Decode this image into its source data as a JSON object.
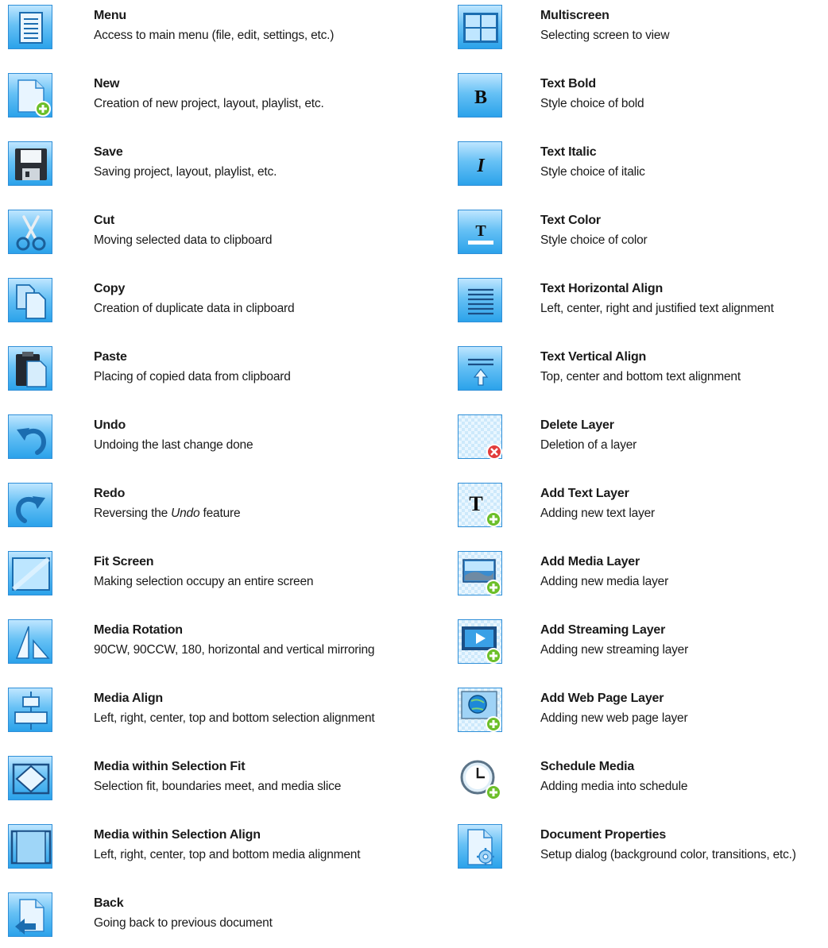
{
  "left_items": [
    {
      "title": "Menu",
      "desc": "Access to main menu  (file, edit, settings, etc.)",
      "icon": "menu-icon"
    },
    {
      "title": "New",
      "desc": "Creation of new project, layout, playlist, etc.",
      "icon": "new-document-icon"
    },
    {
      "title": "Save",
      "desc": "Saving project, layout, playlist, etc.",
      "icon": "floppy-disk-icon"
    },
    {
      "title": "Cut",
      "desc": "Moving selected data to clipboard",
      "icon": "scissors-icon"
    },
    {
      "title": "Copy",
      "desc": "Creation of duplicate data in clipboard",
      "icon": "copy-icon"
    },
    {
      "title": "Paste",
      "desc": "Placing of copied data from clipboard",
      "icon": "paste-icon"
    },
    {
      "title": "Undo",
      "desc": "Undoing the last change done",
      "icon": "undo-arrow-icon"
    },
    {
      "title": "Redo",
      "desc_before": "Reversing the ",
      "desc_em": "Undo",
      "desc_after": " feature",
      "icon": "redo-arrow-icon"
    },
    {
      "title": "Fit Screen",
      "desc": "Making selection occupy an entire screen",
      "icon": "fit-screen-icon"
    },
    {
      "title": "Media Rotation",
      "desc": "90CW, 90CCW, 180, horizontal and vertical mirroring",
      "icon": "mirror-rotate-icon"
    },
    {
      "title": "Media Align",
      "desc": "Left, right, center, top and bottom selection alignment",
      "icon": "align-icon"
    },
    {
      "title": "Media within Selection Fit",
      "desc": "Selection fit, boundaries meet, and media slice",
      "icon": "diamond-fit-icon"
    },
    {
      "title": "Media within Selection Align",
      "desc": "Left, right, center, top and bottom media alignment",
      "icon": "selection-align-icon"
    },
    {
      "title": "Back",
      "desc": "Going back to previous document",
      "icon": "back-document-icon"
    }
  ],
  "right_items": [
    {
      "title": " Multiscreen",
      "desc": "Selecting screen to view",
      "icon": "multiscreen-grid-icon"
    },
    {
      "title": "Text Bold",
      "desc": "Style choice of bold",
      "icon": "bold-icon"
    },
    {
      "title": "Text Italic",
      "desc": "Style choice of italic",
      "icon": "italic-icon"
    },
    {
      "title": "Text Color",
      "desc": "Style choice of color",
      "icon": "text-color-icon"
    },
    {
      "title": "Text Horizontal Align",
      "desc": "Left, center, right and justified text alignment",
      "icon": "horizontal-align-icon"
    },
    {
      "title": "Text Vertical Align",
      "desc": "Top, center and bottom text alignment",
      "icon": "vertical-align-icon"
    },
    {
      "title": "Delete Layer",
      "desc": "Deletion of a layer",
      "icon": "delete-layer-icon"
    },
    {
      "title": "Add Text Layer",
      "desc": "Adding new text layer",
      "icon": "add-text-layer-icon"
    },
    {
      "title": "Add Media Layer",
      "desc": "Adding new media layer",
      "icon": "add-media-layer-icon"
    },
    {
      "title": "Add Streaming Layer",
      "desc": "Adding new streaming layer",
      "icon": "add-streaming-layer-icon"
    },
    {
      "title": "Add Web Page Layer",
      "desc": "Adding new web page layer",
      "icon": "add-web-page-layer-icon"
    },
    {
      "title": "Schedule Media",
      "desc": "Adding media into schedule",
      "icon": "schedule-clock-icon"
    },
    {
      "title": "Document Properties",
      "desc": "Setup dialog (background color, transitions, etc.)",
      "icon": "document-properties-icon"
    }
  ],
  "icon_labels": {
    "bold": "B",
    "italic": "I",
    "text": "T"
  },
  "colors": {
    "icon_light": "#bfe6ff",
    "icon_dark": "#2ba2ea",
    "plus_green": "#6cbf2a",
    "delete_red": "#e23b3b"
  }
}
